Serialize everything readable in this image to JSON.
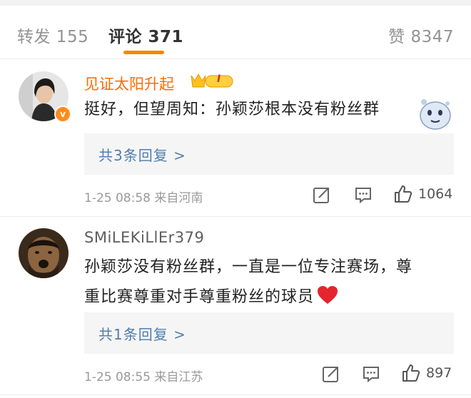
{
  "tabs": {
    "repost": "转发 155",
    "comment": "评论 371",
    "like": "赞 8347"
  },
  "comments": [
    {
      "user": "见证太阳升起",
      "badge_label": "I",
      "text": "挺好，但望周知：孙颖莎根本没有粉丝群",
      "replies": "共3条回复 >",
      "meta": "1-25 08:58 来自河南",
      "likes": "1064"
    },
    {
      "user": "SMiLEKiLlEr379",
      "text_line1": "孙颖莎没有粉丝群，一直是一位专注赛场，尊",
      "text_line2": "重比赛尊重对手尊重粉丝的球员",
      "emoji": "red-heart",
      "replies": "共1条回复 >",
      "meta": "1-25 08:55 来自江苏",
      "likes": "897"
    }
  ],
  "colors": {
    "accent": "#ff8200",
    "link": "#507daf",
    "username_vip": "#ff6b00"
  }
}
